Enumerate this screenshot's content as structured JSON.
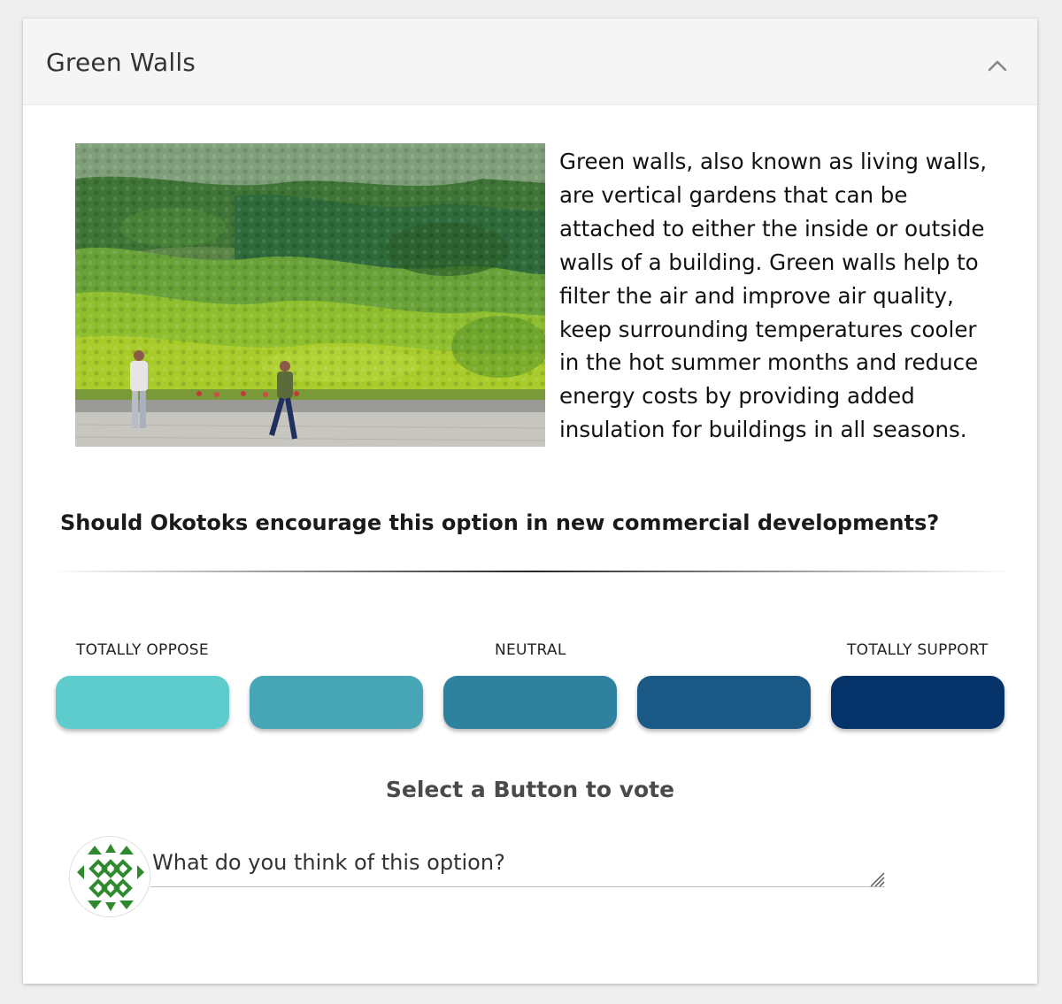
{
  "panel": {
    "title": "Green Walls",
    "collapse_icon": "chevron-up-icon"
  },
  "content": {
    "image_subject": "Vertical garden green wall with two pedestrians walking past",
    "description": "Green walls, also known as living walls, are vertical gardens that can be attached to either the inside or outside walls of a building. Green walls help to filter the air and improve air quality, keep surrounding temperatures cooler in the hot summer months and reduce energy costs by providing added insulation for buildings in all seasons."
  },
  "poll": {
    "question": "Should Okotoks encourage this option in new commercial developments?",
    "scale_labels": {
      "left": "TOTALLY OPPOSE",
      "middle": "NEUTRAL",
      "right": "TOTALLY SUPPORT"
    },
    "options": [
      {
        "color": "#5ecccc"
      },
      {
        "color": "#46a6b5"
      },
      {
        "color": "#2f829d"
      },
      {
        "color": "#1a5886"
      },
      {
        "color": "#053268"
      }
    ],
    "hint": "Select a Button to vote"
  },
  "comment": {
    "avatar_icon": "pattern-avatar-icon",
    "placeholder": "What do you think of this option?"
  }
}
